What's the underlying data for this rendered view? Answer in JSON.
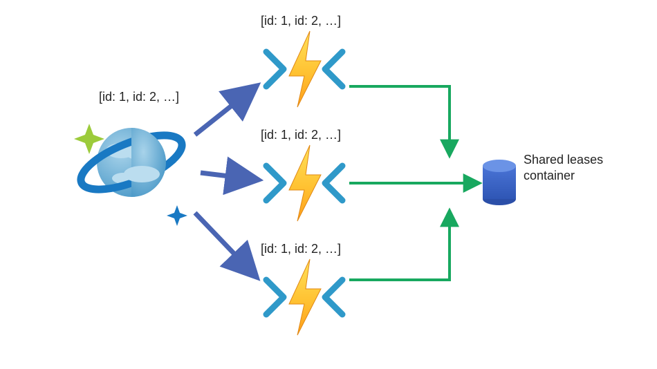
{
  "labels": {
    "source": "[id: 1, id: 2, …]",
    "fn1": "[id: 1, id: 2, …]",
    "fn2": "[id: 1, id: 2, …]",
    "fn3": "[id: 1, id: 2, …]",
    "db": "Shared\nleases\ncontainer"
  },
  "chart_data": {
    "type": "diagram",
    "nodes": [
      {
        "id": "cosmos",
        "kind": "cosmos-db-source",
        "label": "[id: 1, id: 2, …]"
      },
      {
        "id": "fn1",
        "kind": "azure-function",
        "label": "[id: 1, id: 2, …]"
      },
      {
        "id": "fn2",
        "kind": "azure-function",
        "label": "[id: 1, id: 2, …]"
      },
      {
        "id": "fn3",
        "kind": "azure-function",
        "label": "[id: 1, id: 2, …]"
      },
      {
        "id": "leasesdb",
        "kind": "database",
        "label": "Shared leases container"
      }
    ],
    "edges": [
      {
        "from": "cosmos",
        "to": "fn1",
        "color": "blue",
        "meaning": "change-feed"
      },
      {
        "from": "cosmos",
        "to": "fn2",
        "color": "blue",
        "meaning": "change-feed"
      },
      {
        "from": "cosmos",
        "to": "fn3",
        "color": "blue",
        "meaning": "change-feed"
      },
      {
        "from": "fn1",
        "to": "leasesdb",
        "color": "green",
        "meaning": "lease"
      },
      {
        "from": "fn2",
        "to": "leasesdb",
        "color": "green",
        "meaning": "lease"
      },
      {
        "from": "fn3",
        "to": "leasesdb",
        "color": "green",
        "meaning": "lease"
      }
    ]
  }
}
